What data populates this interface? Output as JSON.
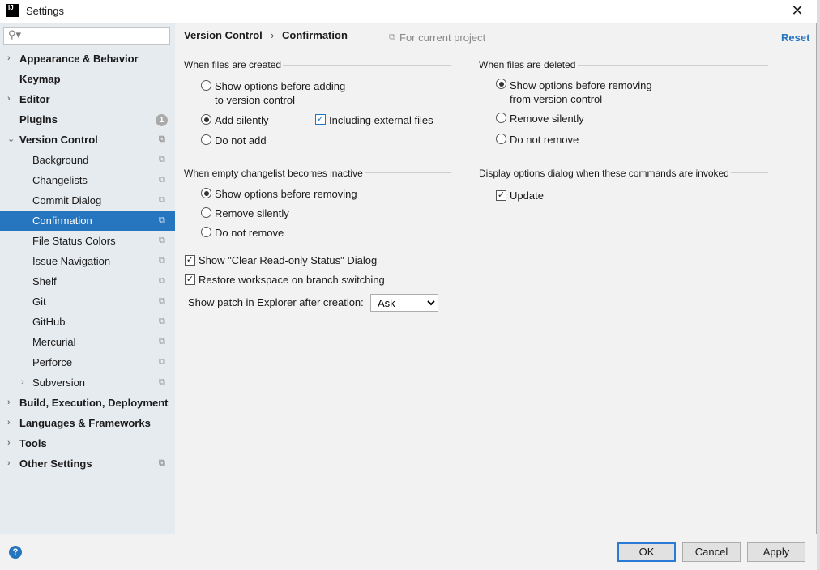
{
  "window": {
    "title": "Settings",
    "logo": "IJ",
    "close_icon": "close-icon"
  },
  "sidebar": {
    "search_placeholder": "",
    "items": [
      {
        "label": "Appearance & Behavior",
        "bold": true,
        "arrow": "›"
      },
      {
        "label": "Keymap",
        "bold": true
      },
      {
        "label": "Editor",
        "bold": true,
        "arrow": "›"
      },
      {
        "label": "Plugins",
        "bold": true,
        "badge": "1"
      },
      {
        "label": "Version Control",
        "bold": true,
        "arrow": "⌄",
        "copy": true
      },
      {
        "label": "Background",
        "indent": true,
        "copy": true
      },
      {
        "label": "Changelists",
        "indent": true,
        "copy": true
      },
      {
        "label": "Commit Dialog",
        "indent": true,
        "copy": true
      },
      {
        "label": "Confirmation",
        "indent": true,
        "copy": true,
        "selected": true
      },
      {
        "label": "File Status Colors",
        "indent": true,
        "copy": true
      },
      {
        "label": "Issue Navigation",
        "indent": true,
        "copy": true
      },
      {
        "label": "Shelf",
        "indent": true,
        "copy": true
      },
      {
        "label": "Git",
        "indent": true,
        "copy": true
      },
      {
        "label": "GitHub",
        "indent": true,
        "copy": true
      },
      {
        "label": "Mercurial",
        "indent": true,
        "copy": true
      },
      {
        "label": "Perforce",
        "indent": true,
        "copy": true
      },
      {
        "label": "Subversion",
        "indent": true,
        "copy": true,
        "arrow": "›"
      },
      {
        "label": "Build, Execution, Deployment",
        "bold": true,
        "arrow": "›"
      },
      {
        "label": "Languages & Frameworks",
        "bold": true,
        "arrow": "›"
      },
      {
        "label": "Tools",
        "bold": true,
        "arrow": "›"
      },
      {
        "label": "Other Settings",
        "bold": true,
        "arrow": "›",
        "copy": true
      }
    ]
  },
  "header": {
    "crumb1": "Version Control",
    "sep": "›",
    "crumb2": "Confirmation",
    "scope": "For current project",
    "reset": "Reset"
  },
  "created": {
    "title": "When files are created",
    "opt1a": "Show options before adding",
    "opt1b": "to version control",
    "opt2": "Add silently",
    "opt3": "Do not add",
    "selected": 2,
    "external": "Including external files",
    "external_checked": true
  },
  "deleted": {
    "title": "When files are deleted",
    "opt1a": "Show options before removing",
    "opt1b": "from version control",
    "opt2": "Remove silently",
    "opt3": "Do not remove",
    "selected": 1
  },
  "empty": {
    "title": "When empty changelist becomes inactive",
    "opt1": "Show options before removing",
    "opt2": "Remove silently",
    "opt3": "Do not remove",
    "selected": 1
  },
  "commands": {
    "title": "Display options dialog when these commands are invoked",
    "update": "Update",
    "update_checked": true
  },
  "misc": {
    "clear_readonly": "Show \"Clear Read-only Status\" Dialog",
    "restore_ws": "Restore workspace on branch switching",
    "patch_label": "Show patch in Explorer after creation:",
    "patch_value": "Ask"
  },
  "footer": {
    "help": "?",
    "ok": "OK",
    "cancel": "Cancel",
    "apply": "Apply"
  },
  "colors": {
    "accent": "#2675bf",
    "sidebar": "#e6ebf0"
  }
}
